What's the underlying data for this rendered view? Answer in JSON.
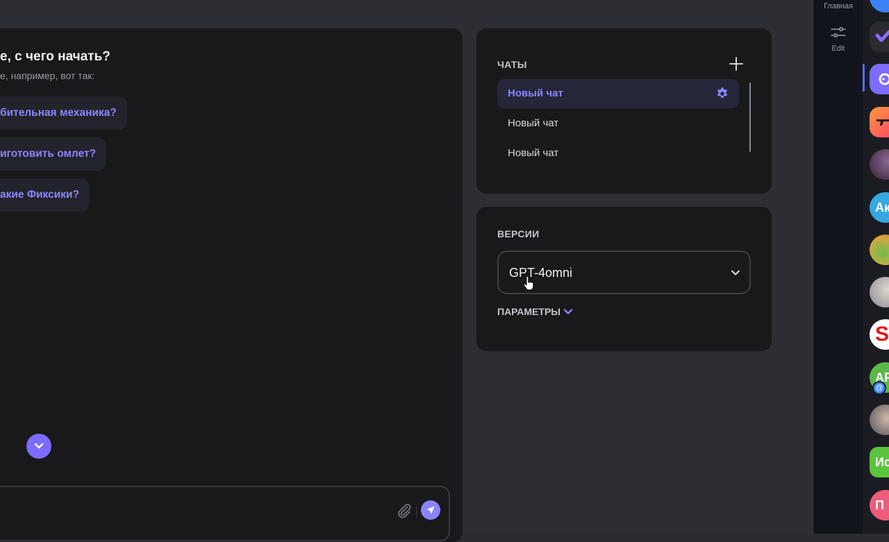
{
  "chat": {
    "welcome_title": "е, с чего начать?",
    "welcome_subtitle": "е, например, вот так:",
    "suggestions": [
      "бительная механика?",
      "иготовить омлет?",
      "акие Фиксики?"
    ]
  },
  "chats_panel": {
    "heading": "ЧАТЫ",
    "items": [
      "Новый чат",
      "Новый чат",
      "Новый чат"
    ]
  },
  "versions_panel": {
    "heading": "ВЕРСИИ",
    "selected_model": "GPT-4omni",
    "params_label": "ПАРАМЕТРЫ"
  },
  "sidenav": {
    "home_label": "Главная",
    "edit_label": "Edit"
  },
  "apps": {
    "ak_label": "Ак",
    "ap_label": "АР",
    "s_label": "S",
    "io_label": "Ис",
    "p_label": "П",
    "at_badge": "@"
  },
  "colors": {
    "accent": "#8c84ff",
    "panel_bg": "#19191c",
    "page_bg": "#2d2e33"
  }
}
